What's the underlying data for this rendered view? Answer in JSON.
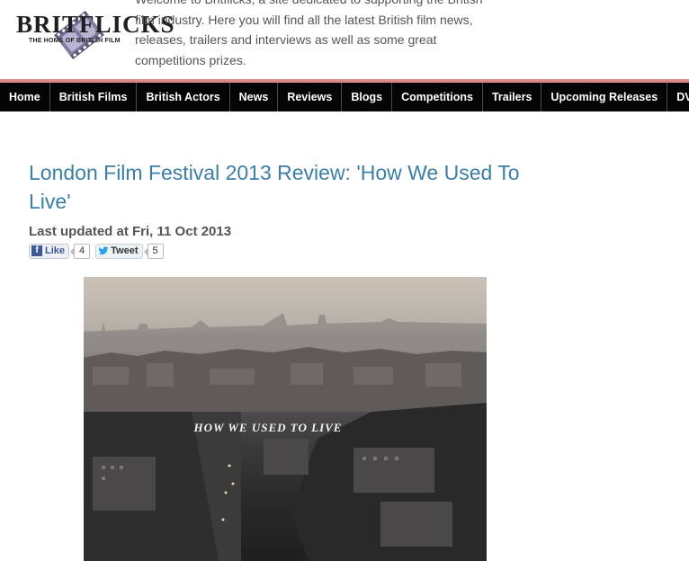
{
  "header": {
    "logo_text": "BRITFLICKS",
    "logo_tagline": "THE HOME OF BRITISH FILM",
    "welcome_lines": [
      "Welcome to Britflicks, a site dedicated to supporting the British",
      "film industry. Here you will find all the latest British film news,",
      "releases, trailers and interviews as well as some great",
      "competitions prizes."
    ]
  },
  "nav": {
    "items": [
      "Home",
      "British Films",
      "British Actors",
      "News",
      "Reviews",
      "Blogs",
      "Competitions",
      "Trailers",
      "Upcoming Releases",
      "DVDs"
    ]
  },
  "article": {
    "title": "London Film Festival 2013 Review: 'How We Used To Live'",
    "updated": "Last updated at Fri, 11 Oct 2013",
    "like_label": "Like",
    "like_count": "4",
    "tweet_label": "Tweet",
    "tweet_count": "5",
    "poster_title": "HOW WE USED TO LIVE"
  },
  "colors": {
    "title": "#3a7fa7",
    "nav_bg": "#050505",
    "accent_line": "#d9888a",
    "facebook": "#3b5998",
    "twitter": "#2aa3ef"
  }
}
